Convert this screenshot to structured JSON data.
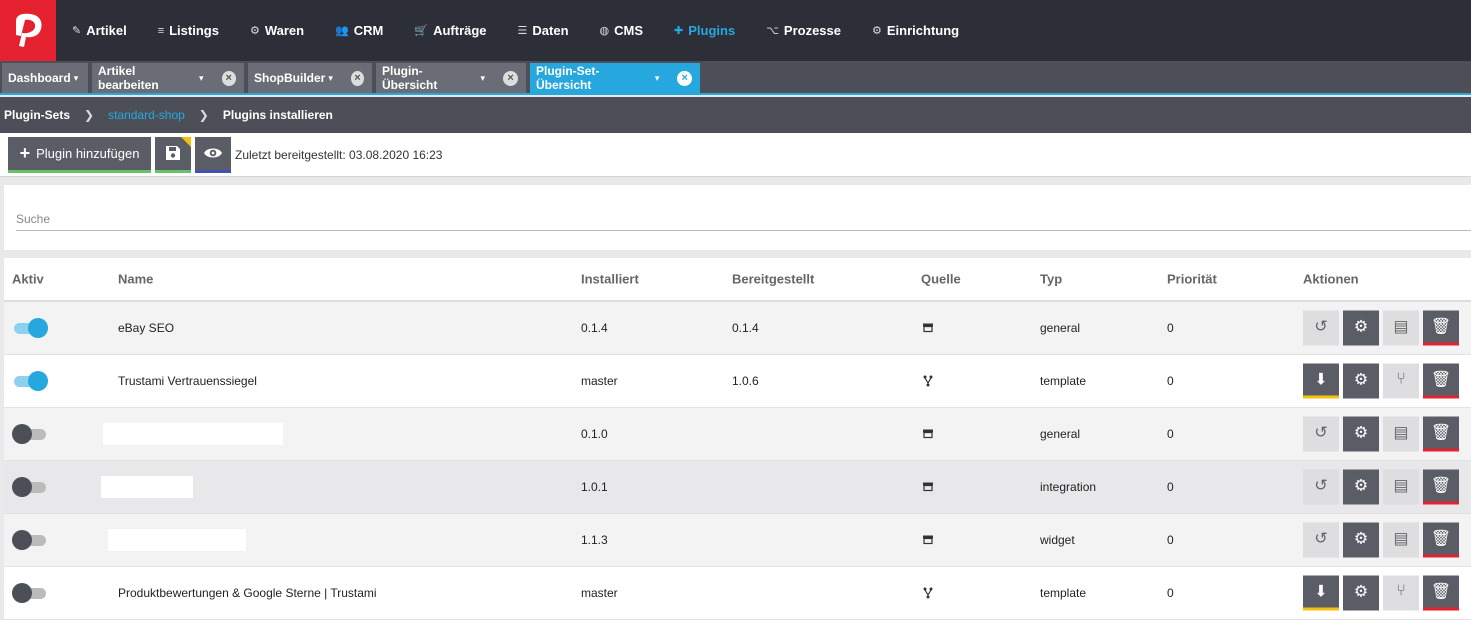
{
  "nav": {
    "items": [
      {
        "icon": "tag-icon",
        "glyph": "✎",
        "label": "Artikel"
      },
      {
        "icon": "listings-icon",
        "glyph": "≡",
        "label": "Listings"
      },
      {
        "icon": "boxes-icon",
        "glyph": "⚙",
        "label": "Waren"
      },
      {
        "icon": "users-icon",
        "glyph": "👥",
        "label": "CRM"
      },
      {
        "icon": "cart-icon",
        "glyph": "🛒",
        "label": "Aufträge"
      },
      {
        "icon": "database-icon",
        "glyph": "☰",
        "label": "Daten"
      },
      {
        "icon": "globe-icon",
        "glyph": "◍",
        "label": "CMS"
      },
      {
        "icon": "puzzle-icon",
        "glyph": "✚",
        "label": "Plugins",
        "active": true
      },
      {
        "icon": "sitemap-icon",
        "glyph": "⌥",
        "label": "Prozesse"
      },
      {
        "icon": "cog-icon",
        "glyph": "⚙",
        "label": "Einrichtung"
      }
    ]
  },
  "tabs": [
    {
      "label": "Dashboard",
      "closable": false
    },
    {
      "label": "Artikel bearbeiten",
      "closable": true
    },
    {
      "label": "ShopBuilder",
      "closable": true
    },
    {
      "label": "Plugin-Übersicht",
      "closable": true
    },
    {
      "label": "Plugin-Set-Übersicht",
      "closable": true,
      "active": true
    }
  ],
  "breadcrumb": {
    "root": "Plugin-Sets",
    "set": "standard-shop",
    "current": "Plugins installieren"
  },
  "toolbar": {
    "add_label": "Plugin hinzufügen",
    "last_deployed": "Zuletzt bereitgestellt: 03.08.2020 16:23"
  },
  "search": {
    "placeholder": "Suche",
    "value": ""
  },
  "table": {
    "headers": {
      "aktiv": "Aktiv",
      "name": "Name",
      "installiert": "Installiert",
      "bereitgestellt": "Bereitgestellt",
      "quelle": "Quelle",
      "typ": "Typ",
      "prioritaet": "Priorität",
      "aktionen": "Aktionen"
    },
    "rows": [
      {
        "active": true,
        "name": "eBay SEO",
        "installed": "0.1.4",
        "deployed": "0.1.4",
        "source": "marketplace",
        "type": "general",
        "priority": "0",
        "first_action": "reset"
      },
      {
        "active": true,
        "name": "Trustami Vertrauenssiegel",
        "installed": "master",
        "deployed": "1.0.6",
        "source": "git",
        "type": "template",
        "priority": "0",
        "first_action": "install"
      },
      {
        "active": false,
        "name": "",
        "installed": "0.1.0",
        "deployed": "",
        "source": "marketplace",
        "type": "general",
        "priority": "0",
        "first_action": "reset"
      },
      {
        "active": false,
        "name": "",
        "installed": "1.0.1",
        "deployed": "",
        "source": "marketplace",
        "type": "integration",
        "priority": "0",
        "first_action": "reset"
      },
      {
        "active": false,
        "name": "",
        "installed": "1.1.3",
        "deployed": "",
        "source": "marketplace",
        "type": "widget",
        "priority": "0",
        "first_action": "reset"
      },
      {
        "active": false,
        "name": "Produktbewertungen & Google Sterne | Trustami",
        "installed": "master",
        "deployed": "",
        "source": "git",
        "type": "template",
        "priority": "0",
        "first_action": "install"
      }
    ]
  },
  "colors": {
    "accent": "#26a8df",
    "brand": "#e5212f",
    "nav_bg": "#2d2f38"
  }
}
